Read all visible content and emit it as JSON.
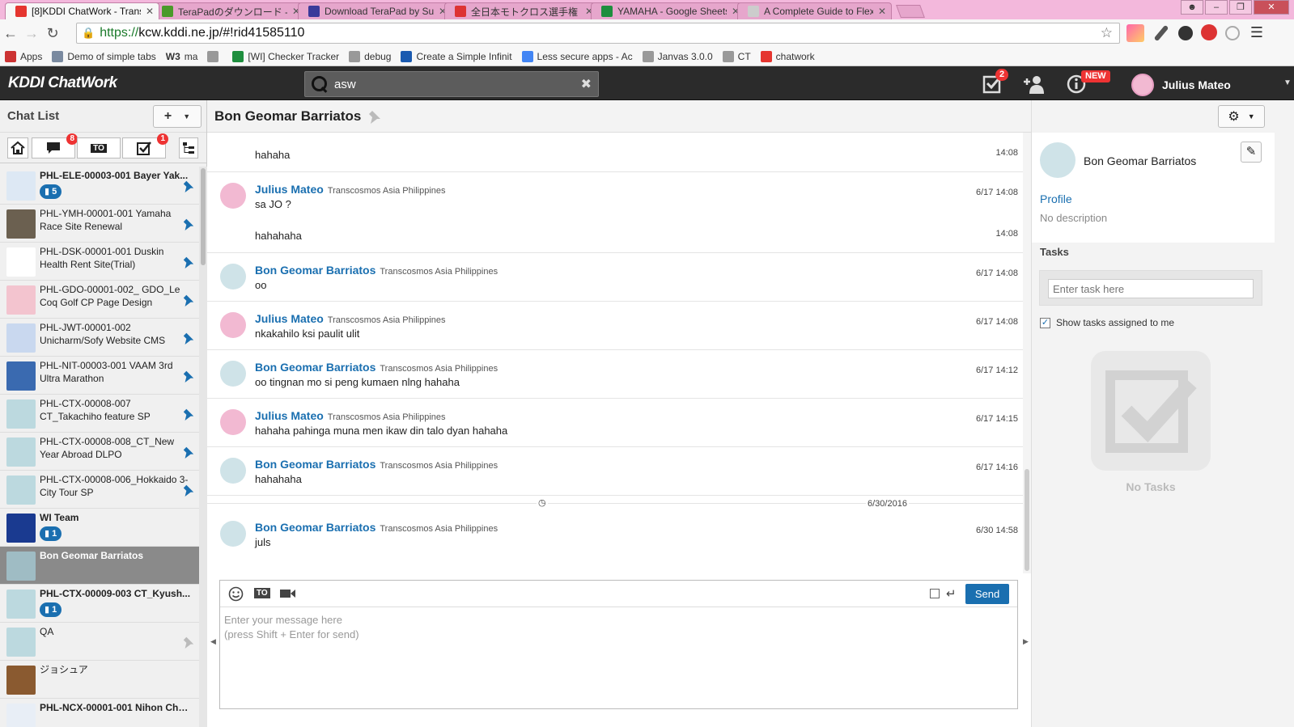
{
  "browser": {
    "tabs": [
      {
        "title": "[8]KDDI ChatWork - Trans",
        "color": "#e5352f",
        "active": true
      },
      {
        "title": "TeraPadのダウンロード -",
        "color": "#4a9a2a",
        "active": false
      },
      {
        "title": "Download TeraPad by Su",
        "color": "#3a3a9a",
        "active": false
      },
      {
        "title": "全日本モトクロス選手権",
        "color": "#d33",
        "active": false
      },
      {
        "title": "YAMAHA - Google Sheets",
        "color": "#1e8e3e",
        "active": false
      },
      {
        "title": "A Complete Guide to Flex",
        "color": "#ccc",
        "active": false
      }
    ],
    "url_scheme": "https://",
    "url_host": "kcw.kddi.ne.jp",
    "url_path": "/#!rid41585110",
    "bookmarks": [
      {
        "label": "Apps",
        "color": "#c33"
      },
      {
        "label": "Demo of simple tabs",
        "color": "#7a8aa0"
      },
      {
        "label": "ma",
        "color": "#333",
        "prefix": "W3"
      },
      {
        "label": "",
        "color": "#999"
      },
      {
        "label": "[WI] Checker Tracker",
        "color": "#1e8e3e"
      },
      {
        "label": "debug",
        "color": "#999"
      },
      {
        "label": "Create a Simple Infinit",
        "color": "#1a5ab0"
      },
      {
        "label": "Less secure apps - Ac",
        "color": "#4285f4"
      },
      {
        "label": "Janvas 3.0.0",
        "color": "#999"
      },
      {
        "label": "CT",
        "color": "#999"
      },
      {
        "label": "chatwork",
        "color": "#e5352f"
      }
    ]
  },
  "header": {
    "logo": "KDDI ChatWork",
    "search_value": "asw",
    "tasks_badge": "2",
    "info_badge": "NEW",
    "user_name": "Julius Mateo"
  },
  "sidebar": {
    "title": "Chat List",
    "filters": {
      "unread_badge": "8",
      "to_label": "TO",
      "tasks_badge": "1"
    },
    "rooms": [
      {
        "name": "PHL-ELE-00003-001 Bayer Yak...",
        "bold": true,
        "count": "5",
        "pinned": true,
        "avatar": "#dde8f4"
      },
      {
        "name": "PHL-YMH-00001-001 Yamaha Race Site Renewal",
        "bold": false,
        "count": null,
        "pinned": true,
        "avatar": "#6b6050"
      },
      {
        "name": "PHL-DSK-00001-001 Duskin Health Rent Site(Trial)",
        "bold": false,
        "count": null,
        "pinned": true,
        "avatar": "#fff"
      },
      {
        "name": "PHL-GDO-00001-002_ GDO_Le Coq Golf CP Page Design",
        "bold": false,
        "count": null,
        "pinned": true,
        "avatar": "#f3c4cf"
      },
      {
        "name": "PHL-JWT-00001-002 Unicharm/Sofy Website CMS",
        "bold": false,
        "count": null,
        "pinned": true,
        "avatar": "#c9d8ef"
      },
      {
        "name": "PHL-NIT-00003-001 VAAM 3rd Ultra Marathon",
        "bold": false,
        "count": null,
        "pinned": true,
        "avatar": "#3a6ab0"
      },
      {
        "name": "PHL-CTX-00008-007 CT_Takachiho feature SP",
        "bold": false,
        "count": null,
        "pinned": true,
        "avatar": "#bcd9df"
      },
      {
        "name": "PHL-CTX-00008-008_CT_New Year Abroad DLPO",
        "bold": false,
        "count": null,
        "pinned": true,
        "avatar": "#bcd9df"
      },
      {
        "name": "PHL-CTX-00008-006_Hokkaido 3-City Tour SP",
        "bold": false,
        "count": null,
        "pinned": true,
        "avatar": "#bcd9df"
      },
      {
        "name": "WI Team",
        "bold": true,
        "count": "1",
        "pinned": false,
        "avatar": "#1a3a90"
      },
      {
        "name": "Bon Geomar Barriatos",
        "bold": false,
        "count": null,
        "pinned": false,
        "avatar": "#9fbcc4",
        "selected": true
      },
      {
        "name": "PHL-CTX-00009-003 CT_Kyush...",
        "bold": true,
        "count": "1",
        "pinned": false,
        "avatar": "#bcd9df"
      },
      {
        "name": "QA",
        "bold": false,
        "count": null,
        "pinned": "faded",
        "avatar": "#bcd9df"
      },
      {
        "name": "ジョシュア",
        "bold": false,
        "count": null,
        "pinned": false,
        "avatar": "#8a5a30"
      },
      {
        "name": "PHL-NCX-00001-001 Nihon Cho...",
        "bold": true,
        "count": null,
        "pinned": false,
        "avatar": "#e8eef6"
      }
    ]
  },
  "chat": {
    "title": "Bon Geomar Barriatos",
    "org": "Transcosmos Asia Philippines",
    "messages": [
      {
        "who": null,
        "text": "hahaha",
        "time": "14:08"
      },
      {
        "who": "Julius Mateo",
        "text": "sa JO ?",
        "time": "6/17 14:08"
      },
      {
        "who": null,
        "text": "hahahaha",
        "time": "14:08"
      },
      {
        "who": "Bon Geomar Barriatos",
        "text": "oo",
        "time": "6/17 14:08"
      },
      {
        "who": "Julius Mateo",
        "text": "nkakahilo ksi paulit ulit",
        "time": "6/17 14:08"
      },
      {
        "who": "Bon Geomar Barriatos",
        "text": "oo tingnan mo si peng kumaen nlng hahaha",
        "time": "6/17 14:12"
      },
      {
        "who": "Julius Mateo",
        "text": "hahaha pahinga muna men ikaw din talo dyan hahaha",
        "time": "6/17 14:15"
      },
      {
        "who": "Bon Geomar Barriatos",
        "text": "hahahaha",
        "time": "6/17 14:16"
      },
      {
        "who": "Bon Geomar Barriatos",
        "text": "juls",
        "time": "6/30 14:58"
      }
    ],
    "date_separator": "6/30/2016",
    "composer": {
      "to_label": "TO",
      "send_label": "Send",
      "placeholder": "Enter your message here\n(press Shift + Enter for send)"
    }
  },
  "right_panel": {
    "name": "Bon Geomar Barriatos",
    "profile_link": "Profile",
    "description": "No description",
    "tasks_title": "Tasks",
    "task_placeholder": "Enter task here",
    "show_assigned": "Show tasks assigned to me",
    "no_tasks": "No Tasks"
  },
  "colors": {
    "accent": "#1a6fb0",
    "header_bg": "#2b2b2b",
    "badge": "#e33"
  }
}
